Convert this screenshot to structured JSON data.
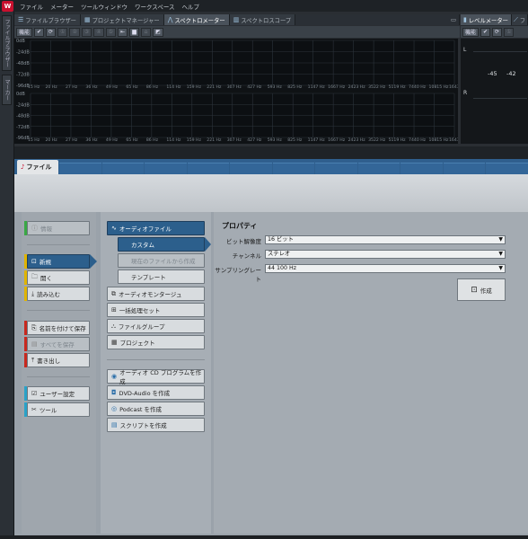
{
  "menubar": {
    "app_icon": "W",
    "items": [
      "ファイル",
      "メーター",
      "ツールウィンドウ",
      "ワークスペース",
      "ヘルプ"
    ]
  },
  "leftstrip": {
    "tab1": "ファイルブラウザー",
    "tab2": "マーカー"
  },
  "tabs": [
    {
      "label": "ファイルブラウザー",
      "icon": "list-icon"
    },
    {
      "label": "プロジェクトマネージャー",
      "icon": "grid-icon"
    },
    {
      "label": "スペクトロメーター",
      "icon": "spectrum-icon"
    },
    {
      "label": "スペクトロスコープ",
      "icon": "bars-icon"
    }
  ],
  "toolbar": {
    "function_label": "機能"
  },
  "spectrum": {
    "y_labels": [
      "0dB",
      "-24dB",
      "-48dB",
      "-72dB",
      "-96dB"
    ],
    "freqs": [
      "15 Hz",
      "20 Hz",
      "27 Hz",
      "36 Hz",
      "49 Hz",
      "65 Hz",
      "86 Hz",
      "114 Hz",
      "159 Hz",
      "221 Hz",
      "307 Hz",
      "427 Hz",
      "593 Hz",
      "825 Hz",
      "1147 Hz",
      "1667 Hz",
      "2423 Hz",
      "3522 Hz",
      "5119 Hz",
      "7440 Hz",
      "10815 Hz",
      "16436 Hz"
    ]
  },
  "level_meter": {
    "tab_label": "レベルメーター",
    "tab2_label": "フ",
    "function_label": "機能",
    "channel_left": "L",
    "channel_right": "R",
    "value1": "-45",
    "value2": "-42"
  },
  "filewindow": {
    "tab_label": "ファイル"
  },
  "nav": {
    "info": "情報",
    "new": "新規",
    "open": "開く",
    "import": "読み込む",
    "save_as": "名前を付けて保存",
    "save_all": "すべてを保存",
    "export": "書き出し",
    "prefs": "ユーザー設定",
    "tools": "ツール"
  },
  "new_types": {
    "audio_file": "オーディオファイル",
    "custom": "カスタム",
    "from_current": "現在のファイルから作成",
    "template": "テンプレート",
    "audio_montage": "オーディオモンタージュ",
    "batch": "一括処理セット",
    "file_group": "ファイルグループ",
    "project": "プロジェクト",
    "cd": "オーディオ CD プログラムを作成",
    "dvd": "DVD-Audio を作成",
    "podcast": "Podcast を作成",
    "script": "スクリプトを作成"
  },
  "properties": {
    "title": "プロパティ",
    "bit_label": "ビット解像度",
    "bit_value": "16 ビット",
    "channel_label": "チャンネル",
    "channel_value": "ステレオ",
    "rate_label": "サンプリングレート",
    "rate_value": "44 100 Hz",
    "create_button": "作成"
  },
  "colors": {
    "accent_blue": "#2c5f8c",
    "green": "#3aa845",
    "yellow": "#e0b400",
    "red": "#c8281e",
    "cyan": "#2aa2c8"
  }
}
